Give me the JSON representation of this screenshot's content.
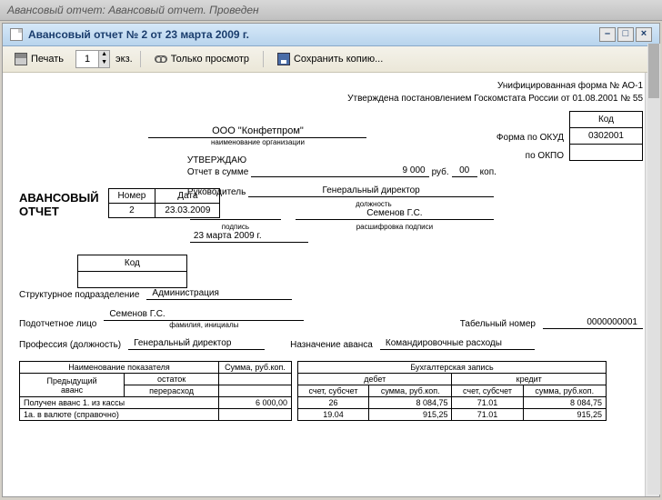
{
  "window": {
    "title": "Авансовый отчет: Авансовый отчет. Проведен"
  },
  "inner": {
    "title": "Авансовый отчет № 2 от 23 марта 2009 г."
  },
  "toolbar": {
    "print": "Печать",
    "copies": "1",
    "copies_unit": "экз.",
    "view_only": "Только просмотр",
    "save_copy": "Сохранить копию..."
  },
  "form": {
    "header1": "Унифицированная форма № АО-1",
    "header2": "Утверждена постановлением Госкомстата России от  01.08.2001 № 55",
    "code_label": "Код",
    "okud_label": "Форма по ОКУД",
    "okud_value": "0302001",
    "okpo_label": "по ОКПО",
    "okpo_value": "",
    "org_name": "ООО \"Конфетпром\"",
    "org_caption": "наименование организации",
    "approve_title": "УТВЕРЖДАЮ",
    "sum_label": "Отчет в сумме",
    "sum_rub": "9 000",
    "rub_unit": "руб.",
    "sum_kop": "00",
    "kop_unit": "коп.",
    "manager_label": "Руководитель",
    "manager_position": "Генеральный директор",
    "position_caption": "должность",
    "manager_name": "Семенов Г.С.",
    "signature_caption": "подпись",
    "name_caption": "расшифровка подписи",
    "approve_date": "23 марта 2009 г.",
    "doc_title": "АВАНСОВЫЙ  ОТЧЕТ",
    "num_label": "Номер",
    "date_label": "Дата",
    "doc_number": "2",
    "doc_date": "23.03.2009",
    "code2_label": "Код",
    "code2_value": "",
    "division_label": "Структурное подразделение",
    "division_value": "Администрация",
    "person_label": "Подотчетное лицо",
    "person_value": "Семенов Г.С.",
    "person_caption": "фамилия, инициалы",
    "tab_number_label": "Табельный номер",
    "tab_number_value": "0000000001",
    "profession_label": "Профессия (должность)",
    "profession_value": "Генеральный директор",
    "advance_purpose_label": "Назначение аванса",
    "advance_purpose_value": "Командировочные расходы"
  },
  "table1": {
    "h1": "Наименование показателя",
    "h2": "Сумма, руб.коп.",
    "sub1a": "Предыдущий",
    "sub1b": "остаток",
    "sub2": "аванс",
    "sub3": "перерасход",
    "rows": [
      {
        "name": "Получен аванс 1. из кассы",
        "sum": "6 000,00"
      },
      {
        "name": "1а. в валюте (справочно)",
        "sum": ""
      }
    ]
  },
  "table2": {
    "h": "Бухгалтерская запись",
    "debit": "дебет",
    "credit": "кредит",
    "acct": "счет, субсчет",
    "amount": "сумма, руб.коп.",
    "rows": [
      {
        "dacct": "26",
        "damt": "8 084,75",
        "cacct": "71.01",
        "camt": "8 084,75"
      },
      {
        "dacct": "19.04",
        "damt": "915,25",
        "cacct": "71.01",
        "camt": "915,25"
      }
    ]
  }
}
